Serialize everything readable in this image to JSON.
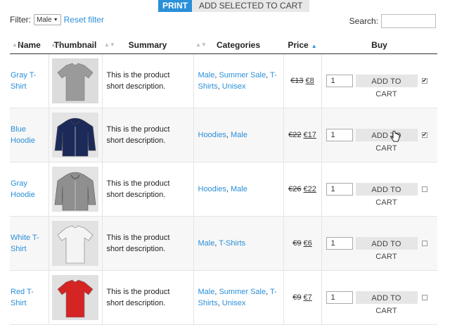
{
  "toolbar": {
    "print_label": "PRINT",
    "add_selected_label": "ADD SELECTED TO CART"
  },
  "filter": {
    "label": "Filter:",
    "selected": "Male",
    "reset_label": "Reset filter"
  },
  "search": {
    "label": "Search:",
    "value": ""
  },
  "columns": {
    "name": "Name",
    "thumbnail": "Thumbnail",
    "summary": "Summary",
    "categories": "Categories",
    "price": "Price",
    "buy": "Buy"
  },
  "products": [
    {
      "name_line1": "Gray T-",
      "name_line2": "Shirt",
      "summary_line1": "This is the product",
      "summary_line2": "short description.",
      "categories": [
        "Male",
        "Summer Sale",
        "T-Shirts",
        "Unisex"
      ],
      "old_price": "€13",
      "new_price": "€8",
      "qty": "1",
      "add_label": "ADD TO CART",
      "checked": true,
      "thumb_color": "#9a9a9a",
      "thumb_bg": "#dcdcdc",
      "thumb_label": "T-shirt"
    },
    {
      "name_line1": "Blue",
      "name_line2": "Hoodie",
      "summary_line1": "This is the product",
      "summary_line2": "short description.",
      "categories": [
        "Hoodies",
        "Male"
      ],
      "old_price": "€22",
      "new_price": "€17",
      "qty": "1",
      "add_label": "ADD TO CART",
      "checked": true,
      "thumb_color": "#1c2a5a",
      "thumb_bg": "#e4e4e4",
      "thumb_label": "hoodie"
    },
    {
      "name_line1": "Gray",
      "name_line2": "Hoodie",
      "summary_line1": "This is the product",
      "summary_line2": "short description.",
      "categories": [
        "Hoodies",
        "Male"
      ],
      "old_price": "€26",
      "new_price": "€22",
      "qty": "1",
      "add_label": "ADD TO CART",
      "checked": false,
      "thumb_color": "#8f8f8f",
      "thumb_bg": "#e4e4e4",
      "thumb_label": "hoodie"
    },
    {
      "name_line1": "White T-",
      "name_line2": "Shirt",
      "summary_line1": "This is the product",
      "summary_line2": "short description.",
      "categories": [
        "Male",
        "T-Shirts"
      ],
      "old_price": "€9",
      "new_price": "€6",
      "qty": "1",
      "add_label": "ADD TO CART",
      "checked": false,
      "thumb_color": "#f4f4f4",
      "thumb_bg": "#e2e2e2",
      "thumb_label": "T-shirt"
    },
    {
      "name_line1": "Red T-",
      "name_line2": "Shirt",
      "summary_line1": "This is the product",
      "summary_line2": "short description.",
      "categories": [
        "Male",
        "Summer Sale",
        "T-Shirts",
        "Unisex"
      ],
      "old_price": "€9",
      "new_price": "€7",
      "qty": "1",
      "add_label": "ADD TO CART",
      "checked": false,
      "thumb_color": "#d42424",
      "thumb_bg": "#e0e0e0",
      "thumb_label": "T-shirt"
    }
  ],
  "colors": {
    "accent": "#2a8fd8",
    "button_bg": "#e6e6e6"
  },
  "icons": {
    "sort": "sort-icon",
    "cursor": "hand-pointer-icon",
    "dropdown": "chevron-down-icon"
  }
}
